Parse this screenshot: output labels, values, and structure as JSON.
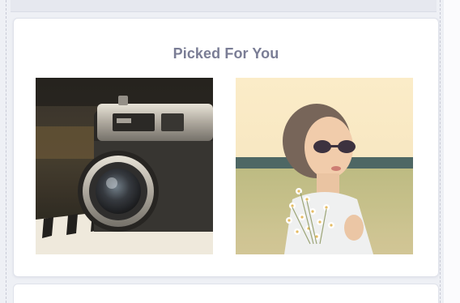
{
  "section": {
    "title": "Picked For You"
  },
  "photos": [
    {
      "subject": "vintage-camera-photo"
    },
    {
      "subject": "woman-with-sunglasses-and-flowers-photo"
    }
  ],
  "colors": {
    "title_text": "#7a7d95",
    "card_bg": "#ffffff",
    "page_bg": "#eef0f5"
  }
}
